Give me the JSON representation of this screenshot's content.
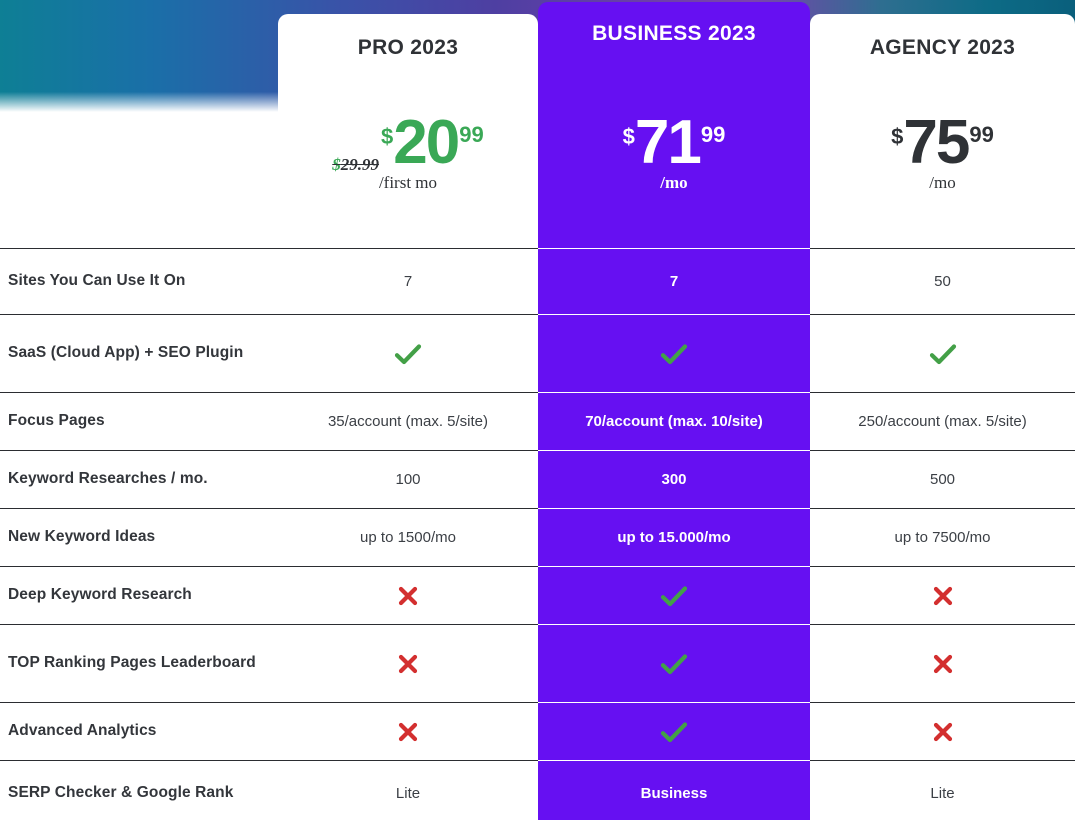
{
  "theme": {
    "highlight_color": "#6610f2",
    "check_color": "#43a047",
    "cross_color": "#d32f2f",
    "price_green": "#3aa856",
    "text_dark": "#33363b",
    "gradient_from": "#0e7f95",
    "gradient_mid": "#4e3fa2",
    "gradient_to": "#0a5f7c"
  },
  "plans": [
    {
      "id": "pro",
      "name": "PRO 2023",
      "old_price": "$29.99",
      "currency": "$",
      "amount": "20",
      "cents": "99",
      "period": "/first mo",
      "highlighted": false
    },
    {
      "id": "business",
      "name": "BUSINESS 2023",
      "old_price": "",
      "currency": "$",
      "amount": "71",
      "cents": "99",
      "period": "/mo",
      "highlighted": true
    },
    {
      "id": "agency",
      "name": "AGENCY 2023",
      "old_price": "",
      "currency": "$",
      "amount": "75",
      "cents": "99",
      "period": "/mo",
      "highlighted": false
    }
  ],
  "features": [
    {
      "label": "Sites You Can Use It On",
      "pro": {
        "type": "text",
        "value": "7"
      },
      "business": {
        "type": "text",
        "value": "7"
      },
      "agency": {
        "type": "text",
        "value": "50"
      }
    },
    {
      "label": "SaaS (Cloud App) + SEO Plugin",
      "pro": {
        "type": "check",
        "value": "included"
      },
      "business": {
        "type": "check",
        "value": "included"
      },
      "agency": {
        "type": "check",
        "value": "included"
      }
    },
    {
      "label": "Focus Pages",
      "pro": {
        "type": "text",
        "value": "35/account (max. 5/site)"
      },
      "business": {
        "type": "text",
        "value": "70/account (max. 10/site)"
      },
      "agency": {
        "type": "text",
        "value": "250/account (max. 5/site)"
      }
    },
    {
      "label": "Keyword Researches / mo.",
      "pro": {
        "type": "text",
        "value": "100"
      },
      "business": {
        "type": "text",
        "value": "300"
      },
      "agency": {
        "type": "text",
        "value": "500"
      }
    },
    {
      "label": "New Keyword Ideas",
      "pro": {
        "type": "text",
        "value": "up to 1500/mo"
      },
      "business": {
        "type": "text",
        "value": "up to 15.000/mo"
      },
      "agency": {
        "type": "text",
        "value": "up to 7500/mo"
      }
    },
    {
      "label": "Deep Keyword Research",
      "pro": {
        "type": "cross",
        "value": "not included"
      },
      "business": {
        "type": "check",
        "value": "included"
      },
      "agency": {
        "type": "cross",
        "value": "not included"
      }
    },
    {
      "label": "TOP Ranking Pages Leaderboard",
      "pro": {
        "type": "cross",
        "value": "not included"
      },
      "business": {
        "type": "check",
        "value": "included"
      },
      "agency": {
        "type": "cross",
        "value": "not included"
      }
    },
    {
      "label": "Advanced Analytics",
      "pro": {
        "type": "cross",
        "value": "not included"
      },
      "business": {
        "type": "check",
        "value": "included"
      },
      "agency": {
        "type": "cross",
        "value": "not included"
      }
    },
    {
      "label": "SERP Checker & Google Rank",
      "pro": {
        "type": "text",
        "value": "Lite"
      },
      "business": {
        "type": "text",
        "value": "Business"
      },
      "agency": {
        "type": "text",
        "value": "Lite"
      }
    }
  ],
  "icons": {
    "check": "check-icon",
    "cross": "cross-icon"
  }
}
